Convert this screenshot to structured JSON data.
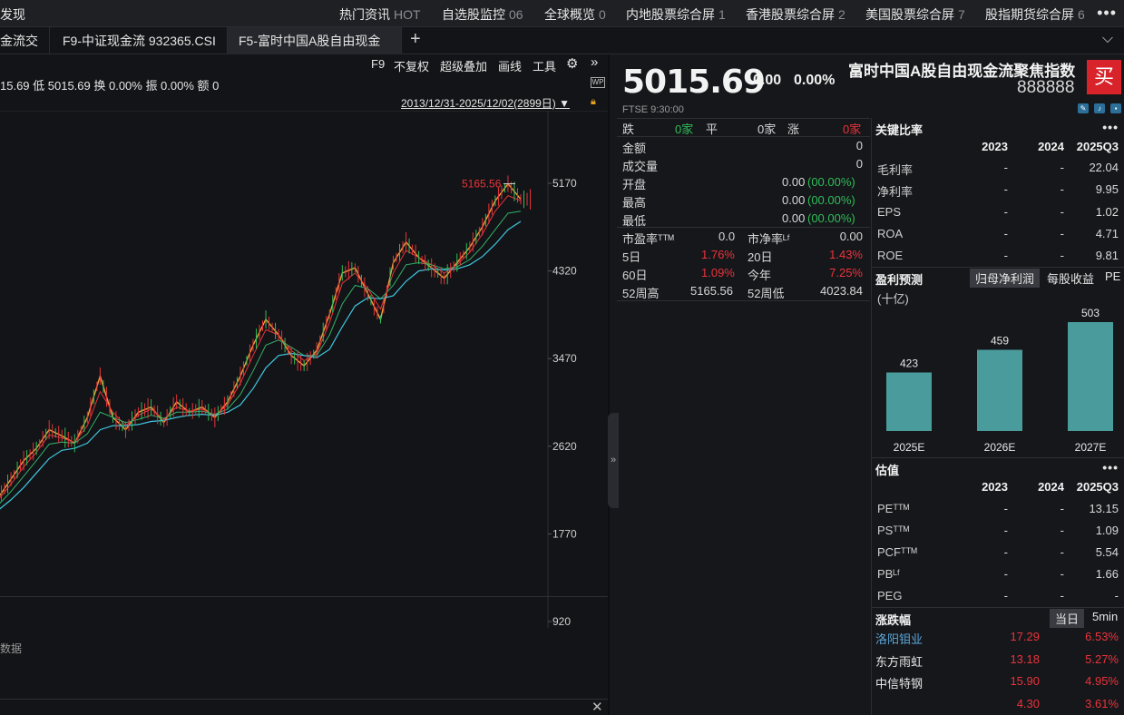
{
  "topbar": {
    "left_label": "发现",
    "items": [
      {
        "label": "热门资讯",
        "count": "HOT"
      },
      {
        "label": "自选股监控",
        "count": "06"
      },
      {
        "label": "全球概览",
        "count": "0"
      },
      {
        "label": "内地股票综合屏",
        "count": "1"
      },
      {
        "label": "香港股票综合屏",
        "count": "2"
      },
      {
        "label": "美国股票综合屏",
        "count": "7"
      },
      {
        "label": "股指期货综合屏",
        "count": "6"
      }
    ],
    "more": "•••"
  },
  "tabs": [
    {
      "label": "金流交"
    },
    {
      "label": "F9-中证现金流 932365.CSI"
    },
    {
      "label": "F5-富时中国A股自由现金"
    }
  ],
  "tab_add": "+",
  "tab_dropdown": "⌵",
  "chart_toolbar": {
    "f9": "F9",
    "adjust": "不复权",
    "overlay": "超级叠加",
    "draw": "画线",
    "tools": "工具",
    "expand": "»"
  },
  "chart_info": "15.69  低 5015.69  换 0.00%  振 0.00%  额 0",
  "date_range": "2013/12/31-2025/12/02(2899日)",
  "wp_label": "WP",
  "sub_chart_text": "数据",
  "chart_data": {
    "type": "line",
    "yticks": [
      920,
      1770,
      2620,
      3470,
      4320,
      5170
    ],
    "ylim": [
      920,
      5300
    ],
    "max_label": "5165.56",
    "series": [
      {
        "values": [
          2120,
          2300,
          2480,
          2600,
          2780,
          2720,
          2650,
          2900,
          3300,
          2900,
          2780,
          2950,
          3000,
          2850,
          3050,
          2950,
          3000,
          2900,
          3050,
          3300,
          3600,
          3850,
          3700,
          3500,
          3400,
          3550,
          3900,
          4300,
          4350,
          4100,
          3850,
          4400,
          4600,
          4450,
          4350,
          4250,
          4400,
          4550,
          4750,
          5000,
          5165,
          5015
        ]
      },
      {
        "values": [
          2100,
          2250,
          2420,
          2560,
          2730,
          2700,
          2660,
          2820,
          3150,
          2950,
          2820,
          2920,
          2980,
          2880,
          3000,
          2960,
          2980,
          2920,
          3020,
          3230,
          3500,
          3750,
          3700,
          3550,
          3450,
          3520,
          3820,
          4200,
          4300,
          4150,
          3950,
          4300,
          4520,
          4450,
          4380,
          4300,
          4380,
          4500,
          4680,
          4900,
          5050,
          5000
        ]
      },
      {
        "values": [
          2050,
          2180,
          2330,
          2480,
          2640,
          2660,
          2650,
          2740,
          2950,
          2900,
          2850,
          2880,
          2920,
          2890,
          2950,
          2950,
          2960,
          2930,
          2980,
          3120,
          3350,
          3600,
          3650,
          3580,
          3500,
          3500,
          3700,
          4000,
          4180,
          4150,
          4050,
          4180,
          4380,
          4400,
          4380,
          4340,
          4360,
          4430,
          4560,
          4720,
          4880,
          4900
        ]
      },
      {
        "values": [
          2000,
          2100,
          2220,
          2360,
          2500,
          2580,
          2600,
          2650,
          2780,
          2820,
          2820,
          2830,
          2860,
          2870,
          2900,
          2920,
          2930,
          2920,
          2950,
          3020,
          3180,
          3380,
          3500,
          3520,
          3500,
          3480,
          3560,
          3780,
          3980,
          4060,
          4050,
          4080,
          4220,
          4320,
          4340,
          4330,
          4340,
          4380,
          4460,
          4580,
          4720,
          4800
        ]
      }
    ]
  },
  "quote": {
    "last": "5015.69",
    "change": "0.00",
    "change_pct": "0.00%",
    "exchange_time": "FTSE   9:30:00",
    "down_label": "跌",
    "down_count": "0家",
    "flat_label": "平",
    "flat_count": "0家",
    "up_label": "涨",
    "up_count": "0家",
    "rows": [
      {
        "label": "金额",
        "value": "0"
      },
      {
        "label": "成交量",
        "value": "0"
      }
    ],
    "ohl": [
      {
        "label": "开盘",
        "value": "0.00",
        "pct": "(00.00%)"
      },
      {
        "label": "最高",
        "value": "0.00",
        "pct": "(00.00%)"
      },
      {
        "label": "最低",
        "value": "0.00",
        "pct": "(00.00%)"
      }
    ],
    "pe_label": "市盈率ᵀᵀᴹ",
    "pe_value": "0.0",
    "pb_label": "市净率ᴸᶠ",
    "pb_value": "0.00",
    "d5_label": "5日",
    "d5_value": "1.76%",
    "d20_label": "20日",
    "d20_value": "1.43%",
    "d60_label": "60日",
    "d60_value": "1.09%",
    "ytd_label": "今年",
    "ytd_value": "7.25%",
    "w52h_label": "52周高",
    "w52h_value": "5165.56",
    "w52l_label": "52周低",
    "w52l_value": "4023.84"
  },
  "header": {
    "name": "富时中国A股自由现金流聚焦指数",
    "code": "888888",
    "buy": "买"
  },
  "key_ratios": {
    "title": "关键比率",
    "more": "•••",
    "cols": [
      "2023",
      "2024",
      "2025Q3"
    ],
    "rows": [
      {
        "label": "毛利率",
        "v": [
          "-",
          "-",
          "22.04"
        ]
      },
      {
        "label": "净利率",
        "v": [
          "-",
          "-",
          "9.95"
        ]
      },
      {
        "label": "EPS",
        "v": [
          "-",
          "-",
          "1.02"
        ]
      },
      {
        "label": "ROA",
        "v": [
          "-",
          "-",
          "4.71"
        ]
      },
      {
        "label": "ROE",
        "v": [
          "-",
          "-",
          "9.81"
        ]
      }
    ]
  },
  "forecast": {
    "title": "盈利预测",
    "tabs": [
      "归母净利润",
      "每股收益",
      "PE"
    ],
    "unit": "(十亿)",
    "bars": [
      {
        "year": "2025E",
        "value": 423
      },
      {
        "year": "2026E",
        "value": 459
      },
      {
        "year": "2027E",
        "value": 503
      }
    ]
  },
  "valuation": {
    "title": "估值",
    "more": "•••",
    "cols": [
      "2023",
      "2024",
      "2025Q3"
    ],
    "rows": [
      {
        "label": "PEᵀᵀᴹ",
        "v": [
          "-",
          "-",
          "13.15"
        ]
      },
      {
        "label": "PSᵀᵀᴹ",
        "v": [
          "-",
          "-",
          "1.09"
        ]
      },
      {
        "label": "PCFᵀᵀᴹ",
        "v": [
          "-",
          "-",
          "5.54"
        ]
      },
      {
        "label": "PBᴸᶠ",
        "v": [
          "-",
          "-",
          "1.66"
        ]
      },
      {
        "label": "PEG",
        "v": [
          "-",
          "-",
          "-"
        ]
      }
    ]
  },
  "movers": {
    "title": "涨跌幅",
    "tabs": [
      "当日",
      "5min"
    ],
    "rows": [
      {
        "name": "洛阳钼业",
        "price": "17.29",
        "pct": "6.53%"
      },
      {
        "name": "东方雨虹",
        "price": "13.18",
        "pct": "5.27%"
      },
      {
        "name": "中信特钢",
        "price": "15.90",
        "pct": "4.95%"
      },
      {
        "name": "",
        "price": "4.30",
        "pct": "3.61%"
      }
    ]
  },
  "colors": {
    "up": "#e8343a",
    "down": "#2fbd58",
    "bar": "#4a9b9b"
  }
}
